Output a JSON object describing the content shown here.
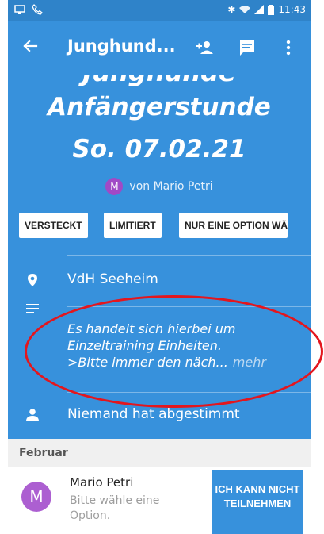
{
  "status_bar": {
    "time": "11:43",
    "icons": [
      "bluetooth-icon",
      "wifi-icon",
      "signal-icon",
      "battery-icon"
    ]
  },
  "app_bar": {
    "title": "Junghund...",
    "actions": [
      "add-person-icon",
      "message-icon",
      "more-vert-icon"
    ]
  },
  "event": {
    "title_top_cut": "Junghunde",
    "title_line": "Anfängerstunde",
    "date": "So. 07.02.21",
    "author_initial": "M",
    "author_text": "von Mario Petri"
  },
  "tags": [
    "VERSTECKT",
    "LIMITIERT",
    "NUR EINE OPTION WÄ"
  ],
  "details": {
    "location": "VdH Seeheim",
    "description_lines": [
      "Es handelt sich hierbei um",
      "Einzeltraining Einheiten.",
      ">Bitte immer den näch..."
    ],
    "more_label": "mehr",
    "votes": "Niemand hat abgestimmt"
  },
  "month_header": "Februar",
  "participant": {
    "initial": "M",
    "name": "Mario Petri",
    "subtitle": "Bitte wähle eine Option.",
    "button_label": "ICH KANN NICHT TEILNEHMEN"
  },
  "colors": {
    "primary": "#3791dc",
    "status_bar": "#2f83c9",
    "avatar": "#ac5fd1",
    "annotation": "#e3161e"
  }
}
